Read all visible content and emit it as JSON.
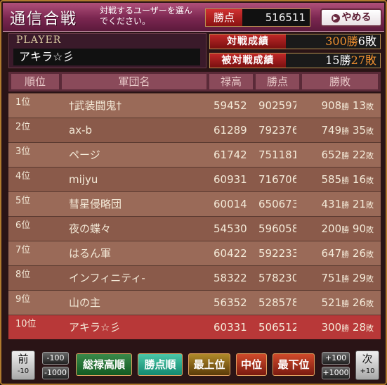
{
  "header": {
    "title": "通信合戦",
    "subtitle": "対戦するユーザーを選んでください。",
    "score_label": "勝点",
    "score_value": "516511",
    "quit_label": "やめる"
  },
  "player": {
    "label": "PLAYER",
    "name": "アキラ☆彡",
    "battle_record_label": "対戦成績",
    "battle_record_wins": "300",
    "battle_record_win_unit": "勝",
    "battle_record_losses": "6",
    "battle_record_loss_unit": "敗",
    "defended_record_label": "被対戦成績",
    "defended_record_wins": "15",
    "defended_record_win_unit": "勝",
    "defended_record_losses": "27",
    "defended_record_loss_unit": "敗"
  },
  "table": {
    "headers": [
      "順位",
      "軍団名",
      "禄高",
      "勝点",
      "勝敗"
    ],
    "win_unit": "勝",
    "loss_unit": "敗",
    "rows": [
      {
        "rank": "1位",
        "name": "†武装闘鬼†",
        "kokudaka": "59452",
        "points": "902597",
        "wins": "908",
        "losses": "13"
      },
      {
        "rank": "2位",
        "name": "ax-b",
        "kokudaka": "61289",
        "points": "792376",
        "wins": "749",
        "losses": "35"
      },
      {
        "rank": "3位",
        "name": "ページ",
        "kokudaka": "61742",
        "points": "751181",
        "wins": "652",
        "losses": "22"
      },
      {
        "rank": "4位",
        "name": "mijyu",
        "kokudaka": "60931",
        "points": "716706",
        "wins": "585",
        "losses": "16"
      },
      {
        "rank": "5位",
        "name": "彗星侵略団",
        "kokudaka": "60014",
        "points": "650673",
        "wins": "431",
        "losses": "21"
      },
      {
        "rank": "6位",
        "name": "夜の蝶々",
        "kokudaka": "54530",
        "points": "596058",
        "wins": "200",
        "losses": "90"
      },
      {
        "rank": "7位",
        "name": "はるん軍",
        "kokudaka": "60422",
        "points": "592233",
        "wins": "647",
        "losses": "26"
      },
      {
        "rank": "8位",
        "name": "インフィニティ-",
        "kokudaka": "58322",
        "points": "578230",
        "wins": "751",
        "losses": "29"
      },
      {
        "rank": "9位",
        "name": "山の主",
        "kokudaka": "56352",
        "points": "528578",
        "wins": "521",
        "losses": "26"
      },
      {
        "rank": "10位",
        "name": "アキラ☆彡",
        "kokudaka": "60331",
        "points": "506512",
        "wins": "300",
        "losses": "28"
      }
    ]
  },
  "footer": {
    "prev_label": "前",
    "prev_sub": "-10",
    "minus100": "-100",
    "minus1000": "-1000",
    "sort_kokudaka": "総禄高順",
    "sort_points": "勝点順",
    "top": "最上位",
    "middle": "中位",
    "bottom": "最下位",
    "plus100": "+100",
    "plus1000": "+1000",
    "next_label": "次",
    "next_sub": "+10"
  }
}
